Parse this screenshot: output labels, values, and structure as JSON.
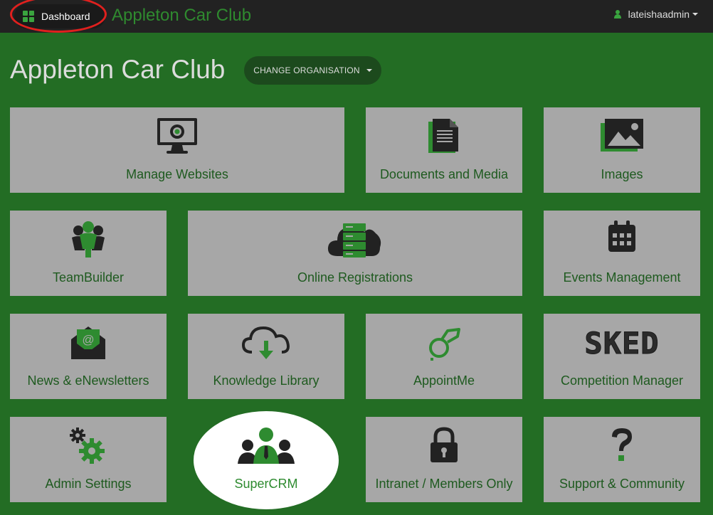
{
  "topbar": {
    "dashboard_label": "Dashboard",
    "brand": "Appleton Car Club",
    "username": "lateishaadmin"
  },
  "header": {
    "org_title": "Appleton Car Club",
    "change_org_label": "CHANGE ORGANISATION"
  },
  "tiles": [
    {
      "label": "Manage Websites",
      "icon": "monitor-icon"
    },
    {
      "label": "Documents and Media",
      "icon": "document-icon"
    },
    {
      "label": "Images",
      "icon": "image-icon"
    },
    {
      "label": "TeamBuilder",
      "icon": "team-icon"
    },
    {
      "label": "Online Registrations",
      "icon": "cloud-server-icon"
    },
    {
      "label": "Events Management",
      "icon": "calendar-icon"
    },
    {
      "label": "News & eNewsletters",
      "icon": "envelope-icon"
    },
    {
      "label": "Knowledge Library",
      "icon": "cloud-download-icon"
    },
    {
      "label": "AppointMe",
      "icon": "whistle-icon"
    },
    {
      "label": "Competition Manager",
      "icon": "sked-logo",
      "logo_text": "SKED"
    },
    {
      "label": "Admin Settings",
      "icon": "gears-icon"
    },
    {
      "label": "SuperCRM",
      "icon": "crm-people-icon"
    },
    {
      "label": "Intranet / Members Only",
      "icon": "padlock-icon"
    },
    {
      "label": "Support & Community",
      "icon": "question-icon"
    }
  ],
  "colors": {
    "background": "#236d24",
    "topbar": "#222222",
    "tile": "#a7a7a7",
    "tile_text": "#1e5a1f",
    "accent": "#3aa43f",
    "highlight_ring": "#e0201e"
  }
}
